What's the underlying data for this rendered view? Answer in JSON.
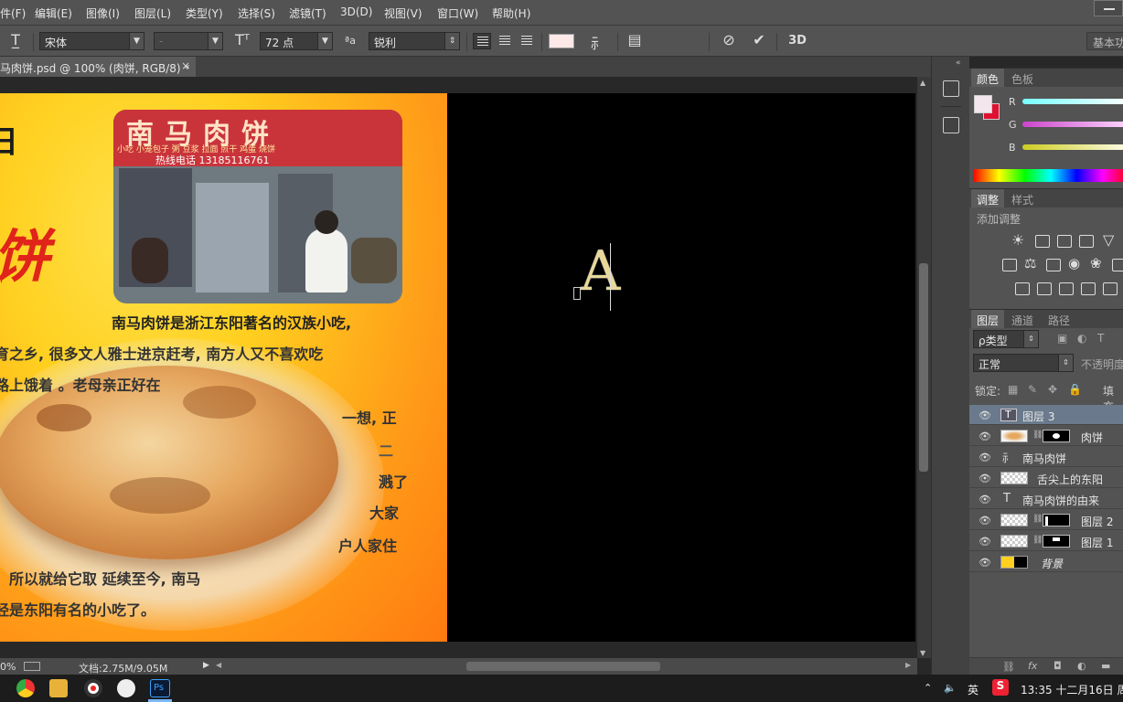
{
  "menu": [
    "件(F)",
    "编辑(E)",
    "图像(I)",
    "图层(L)",
    "类型(Y)",
    "选择(S)",
    "滤镜(T)",
    "3D(D)",
    "视图(V)",
    "窗口(W)",
    "帮助(H)"
  ],
  "options": {
    "font_family": "宋体",
    "font_style": "-",
    "font_size": "72 点",
    "antialias_label": "ªa",
    "antialias": "锐利",
    "threed_label": "3D",
    "workspace": "基本功"
  },
  "document": {
    "tab_title": "马肉饼.psd @ 100% (肉饼, RGB/8) *",
    "close": "×"
  },
  "poster": {
    "sign_title": "南马肉饼",
    "sign_items": "小吃 小笼包子 粥 豆浆 拉面 煎干 鸡蛋 烧饼",
    "sign_phone": "热线电话 13185116761",
    "headline_fragment": "日",
    "side_fragment": "饼",
    "lines": [
      "南马肉饼是浙江东阳著名的汉族小吃,",
      "育之乡, 很多文人雅士进京赶考, 南方人又不喜欢吃",
      "路上饿着          。老母亲正好在",
      "一想, 正",
      "二",
      "溅了",
      "大家",
      "户人家住",
      "所以就给它取              延续至今, 南马",
      "经是东阳有名的小吃了。"
    ]
  },
  "canvas_text": "A",
  "status": {
    "zoom": "0%",
    "doc": "文档:2.75M/9.05M"
  },
  "panels": {
    "color": {
      "tabs": [
        "颜色",
        "色板"
      ],
      "channels": [
        "R",
        "G",
        "B"
      ],
      "fg_color": "#f3e6ec",
      "bg_color": "#e01030"
    },
    "adjust": {
      "tabs": [
        "调整",
        "样式"
      ],
      "add_label": "添加调整"
    },
    "layers": {
      "tabs": [
        "图层",
        "通道",
        "路径"
      ],
      "filter_label": "ρ类型",
      "blend_mode": "正常",
      "opacity_label": "不透明度",
      "lock_label": "锁定:",
      "fill_label": "填充",
      "rows": [
        {
          "name": "图层 3",
          "kind": "text",
          "selected": true
        },
        {
          "name": "肉饼",
          "kind": "image-mask",
          "selected": false
        },
        {
          "name": "南马肉饼",
          "kind": "warp-text",
          "selected": false
        },
        {
          "name": "舌尖上的东阳",
          "kind": "image",
          "selected": false
        },
        {
          "name": "南马肉饼的由来",
          "kind": "text",
          "selected": false
        },
        {
          "name": "图层 2",
          "kind": "image-mask",
          "selected": false
        },
        {
          "name": "图层 1",
          "kind": "image-mask",
          "selected": false
        },
        {
          "name": "背景",
          "kind": "background",
          "selected": false
        }
      ]
    }
  },
  "taskbar": {
    "lang": "英",
    "ime": "S",
    "time": "13:35 十二月16日 周"
  },
  "colors": {
    "ui_bg": "#535353",
    "accent_selected": "#6a7a8c",
    "poster_orange": "#ff9a18",
    "poster_yellow": "#ffe14a"
  }
}
